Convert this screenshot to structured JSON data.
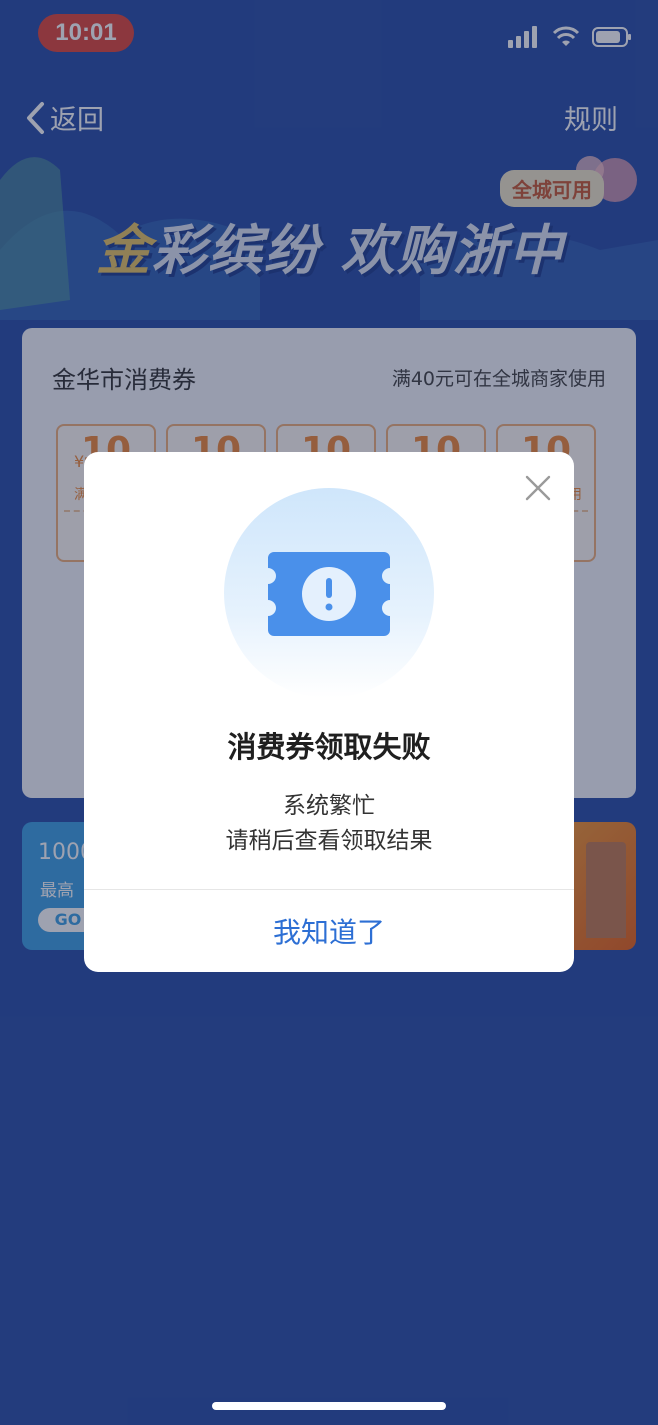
{
  "status_bar": {
    "time": "10:01"
  },
  "nav": {
    "back_label": "返回",
    "rules_label": "规则"
  },
  "banner": {
    "badge": "全城可用",
    "title_gold": "金",
    "title_rest": "彩缤纷 欢购浙中"
  },
  "coupon_card": {
    "title": "金华市消费券",
    "subtitle": "满40元可在全城商家使用",
    "coupons": [
      {
        "currency": "¥",
        "amount": "10",
        "condition": "满"
      },
      {
        "currency": "",
        "amount": "10",
        "condition": ""
      },
      {
        "currency": "",
        "amount": "10",
        "condition": ""
      },
      {
        "currency": "",
        "amount": "10",
        "condition": ""
      },
      {
        "currency": "",
        "amount": "10",
        "condition": "用"
      }
    ]
  },
  "promo_left": {
    "line1": "1000",
    "line2": "最高",
    "go": "GO"
  },
  "dialog": {
    "title": "消费券领取失败",
    "message_line1": "系统繁忙",
    "message_line2": "请稍后查看领取结果",
    "confirm_label": "我知道了",
    "icon": "coupon-alert-icon"
  },
  "colors": {
    "accent": "#2d6fd4",
    "time_pill": "#e0473c",
    "page_bg": "#2a4fa7"
  }
}
